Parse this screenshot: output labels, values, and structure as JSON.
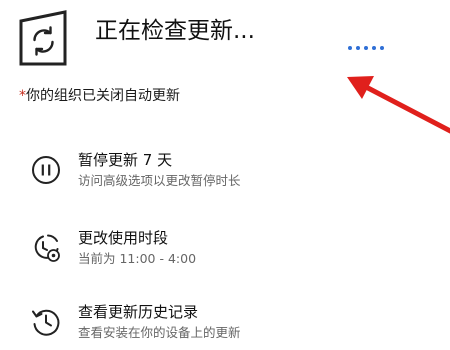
{
  "update_status": {
    "title": "正在检查更新...",
    "icon": "sync-icon",
    "progress": "indeterminate"
  },
  "policy_note": {
    "asterisk": "*",
    "text": "你的组织已关闭自动更新"
  },
  "options": [
    {
      "icon": "pause-icon",
      "title": "暂停更新 7 天",
      "subtitle": "访问高级选项以更改暂停时长"
    },
    {
      "icon": "active-hours-icon",
      "title": "更改使用时段",
      "subtitle": "当前为 11:00 - 4:00"
    },
    {
      "icon": "history-icon",
      "title": "查看更新历史记录",
      "subtitle": "查看安装在你的设备上的更新"
    }
  ],
  "colors": {
    "accent": "#2f6fd6",
    "annotation_arrow": "#e0201c",
    "policy_asterisk": "#c42b1c"
  }
}
